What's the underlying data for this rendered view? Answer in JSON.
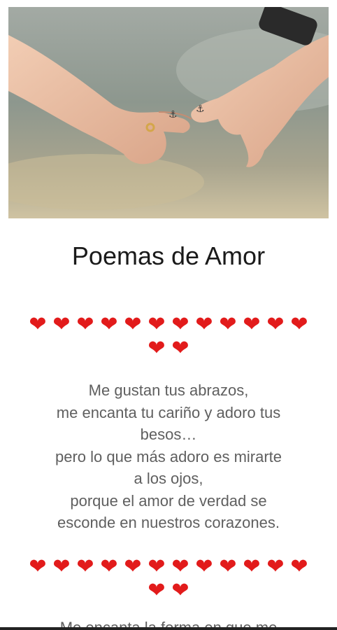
{
  "title": "Poemas de Amor",
  "image": {
    "alt": "hands-holding-pinky-fingers"
  },
  "hearts": {
    "symbol": "❤",
    "color": "#e21b1b",
    "count": 14
  },
  "poem": {
    "lines": [
      "Me gustan tus abrazos,",
      "me encanta tu cariño y adoro tus",
      "besos…",
      "pero lo que más adoro es mirarte",
      "a los ojos,",
      "porque el amor de verdad se",
      "esconde en nuestros corazones."
    ]
  },
  "next_text": "Me encanta la forma en que me"
}
